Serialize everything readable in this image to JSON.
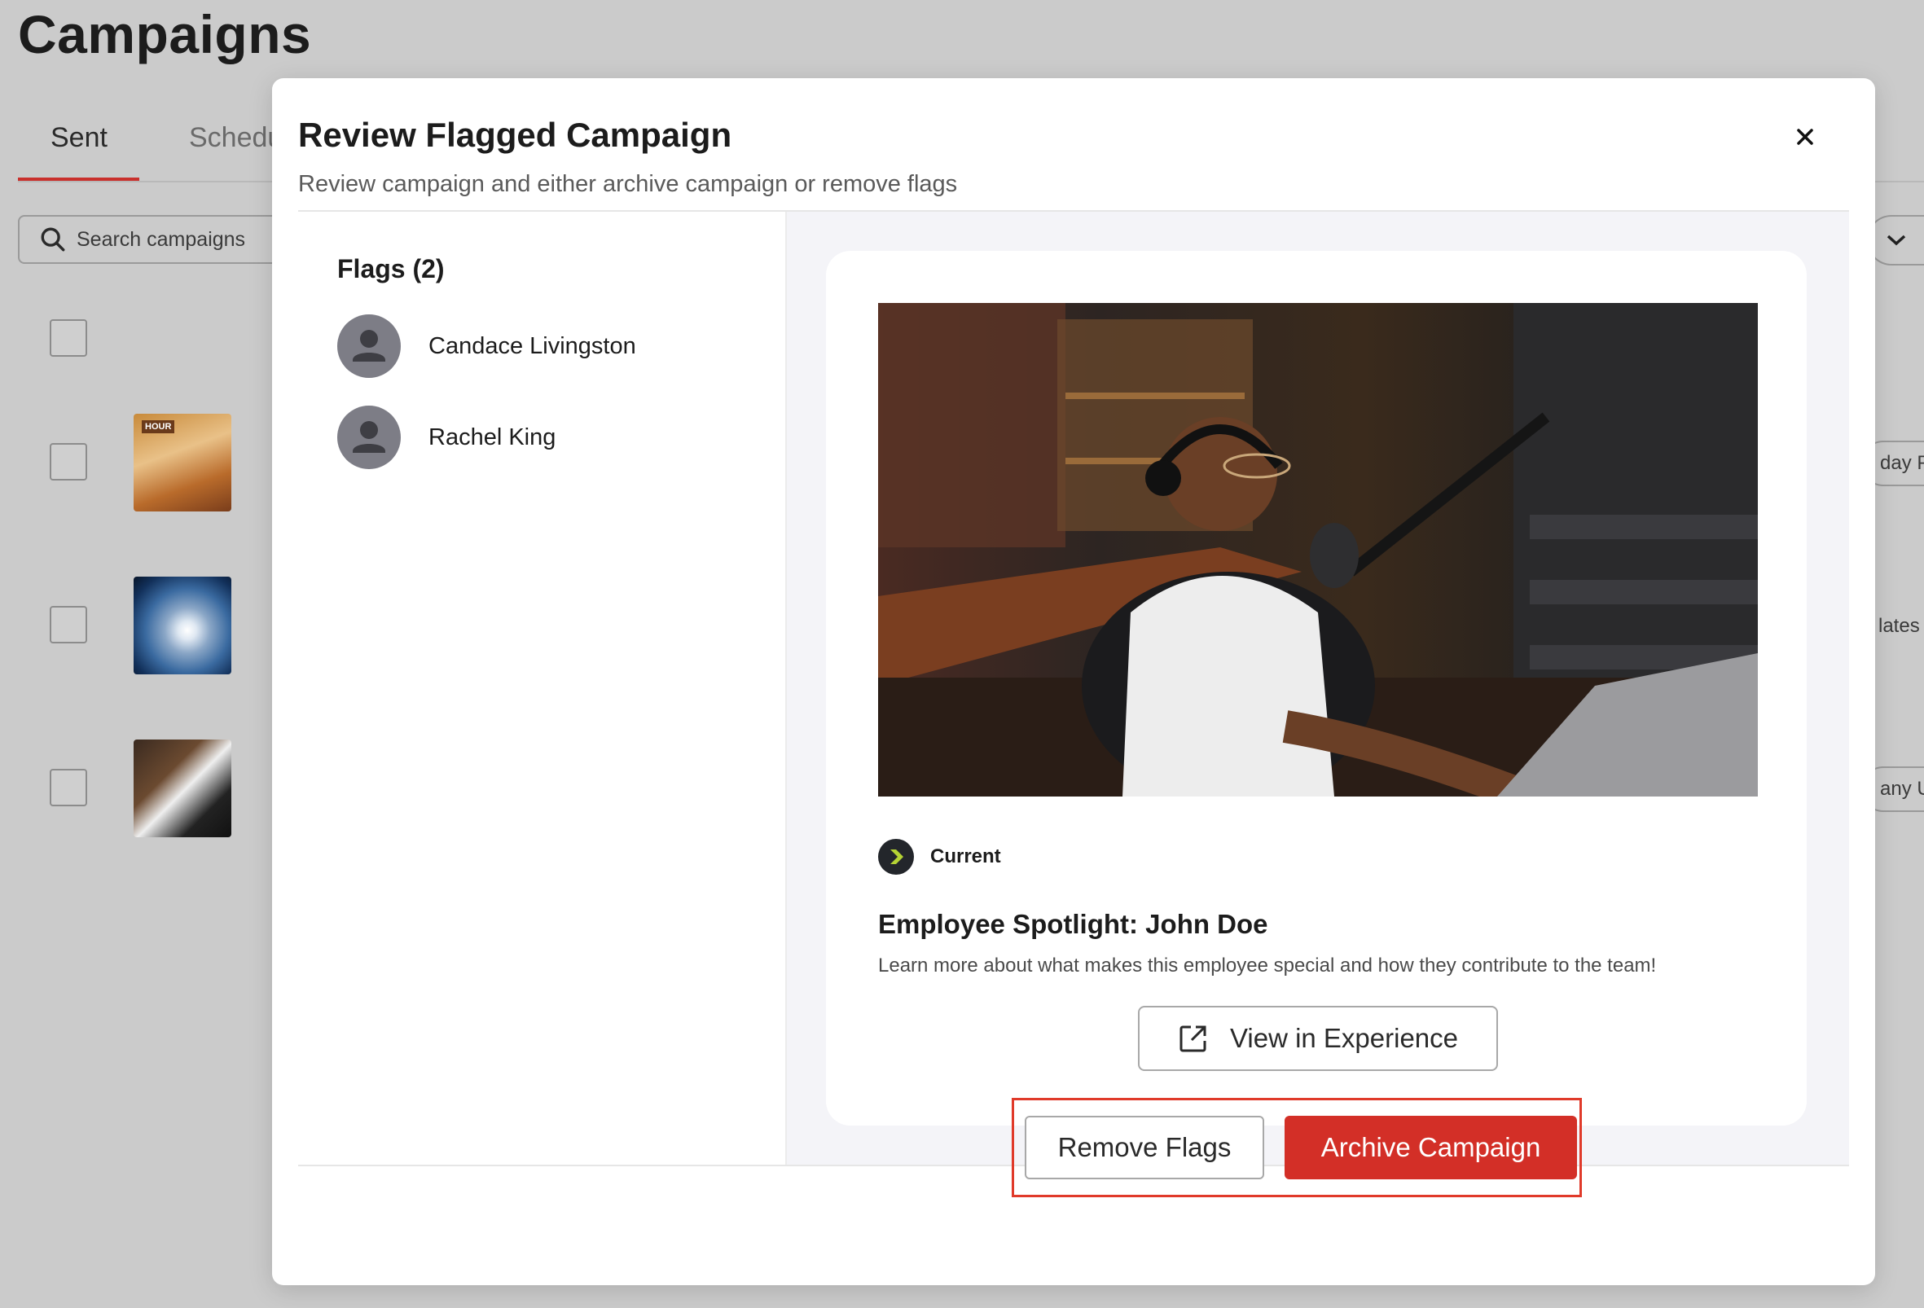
{
  "background": {
    "page_title": "Campaigns",
    "tabs": [
      {
        "label": "Sent",
        "active": true
      },
      {
        "label": "Schedu"
      }
    ],
    "search_placeholder": "Search campaigns",
    "row_tags": [
      "day P",
      "lates",
      "any U"
    ],
    "thumb_tag": "HOUR"
  },
  "modal": {
    "title": "Review Flagged Campaign",
    "subtitle": "Review campaign and either archive campaign or remove flags",
    "close_icon": "close-icon",
    "flags": {
      "heading": "Flags (2)",
      "items": [
        {
          "name": "Candace Livingston",
          "icon": "user-avatar-icon"
        },
        {
          "name": "Rachel King",
          "icon": "user-avatar-icon"
        }
      ]
    },
    "preview": {
      "source": "Current",
      "title": "Employee Spotlight: John Doe",
      "description": "Learn more about what makes this employee special and how they contribute to the team!",
      "view_button": "View in Experience",
      "view_button_icon": "external-link-icon"
    },
    "footer": {
      "remove_button": "Remove Flags",
      "archive_button": "Archive Campaign"
    }
  },
  "colors": {
    "accent_red": "#d32f27",
    "highlight_border": "#e03a2a",
    "overlay_gray": "#cbcbcb"
  }
}
